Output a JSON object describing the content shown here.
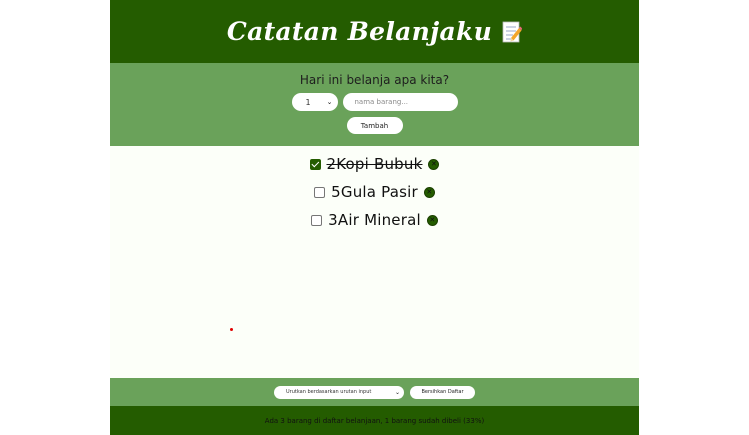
{
  "header": {
    "title": "Catatan Belanjaku",
    "icon": "memo-icon"
  },
  "form": {
    "question": "Hari ini belanja apa kita?",
    "quantity_value": "1",
    "name_placeholder": "nama barang...",
    "add_label": "Tambah"
  },
  "items": [
    {
      "quantity": "2",
      "name": "Kopi Bubuk",
      "text": "2Kopi Bubuk",
      "packed": true
    },
    {
      "quantity": "5",
      "name": "Gula Pasir",
      "text": "5Gula Pasir",
      "packed": false
    },
    {
      "quantity": "3",
      "name": "Air Mineral",
      "text": "3Air Mineral",
      "packed": false
    }
  ],
  "controls": {
    "sort_value": "Urutkan berdasarkan urutan input",
    "clear_label": "Bersihkan Daftar"
  },
  "footer": {
    "stats": "Ada 3 barang di daftar belanjaan, 1 barang sudah dibeli (33%)"
  },
  "colors": {
    "dark_green": "#245c00",
    "light_green": "#6aa25a",
    "cursor_dot": "#e10000"
  }
}
